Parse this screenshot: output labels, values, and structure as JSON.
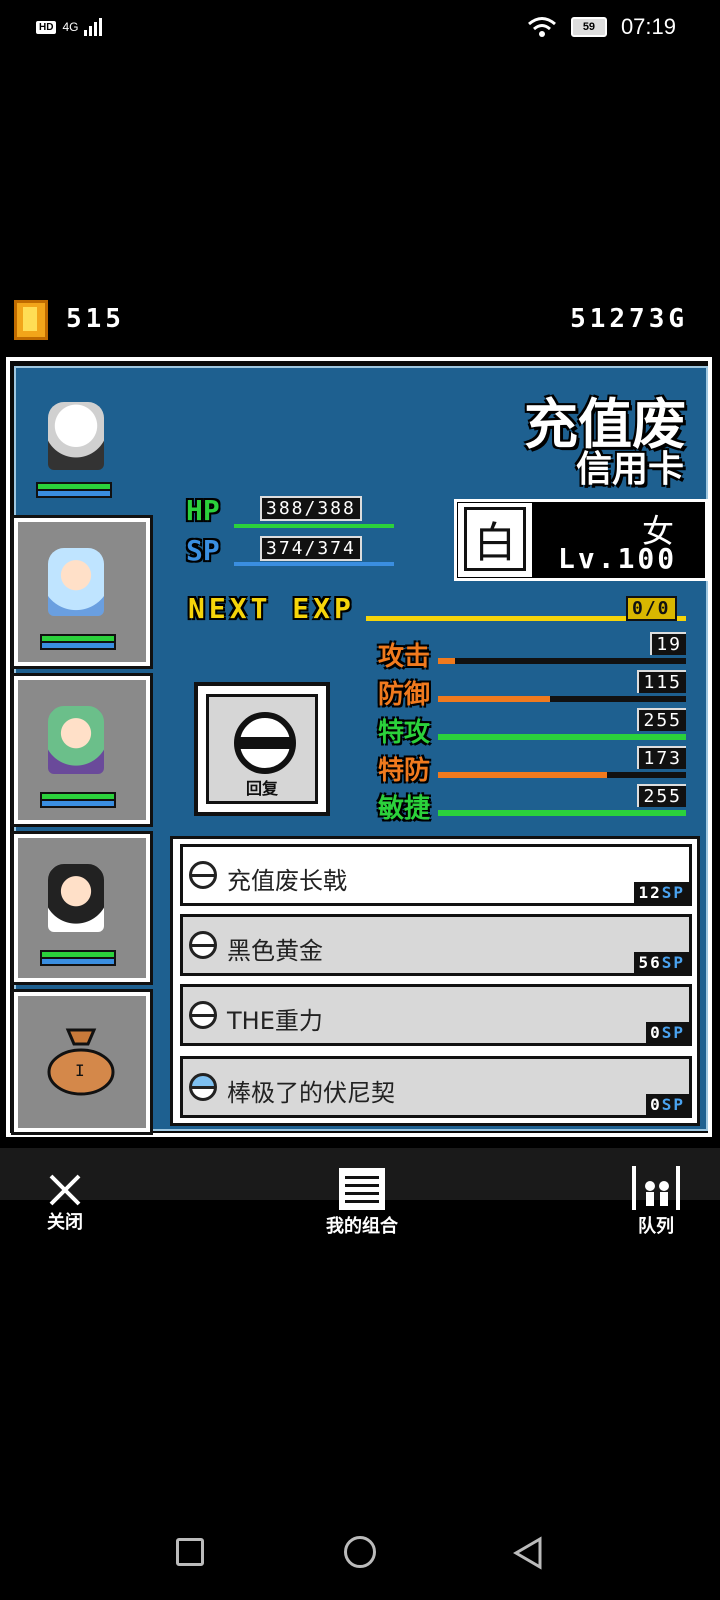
{
  "status_bar": {
    "hd": "HD",
    "network": "4G",
    "battery": "59",
    "time": "07:19"
  },
  "currency": {
    "coins": "515",
    "gold": "51273G"
  },
  "character": {
    "name": "充值废",
    "title": "信用卡",
    "gender": "女",
    "level": "Lv.100",
    "element_char": "白",
    "hp_label": "HP",
    "hp_value": "388/388",
    "sp_label": "SP",
    "sp_value": "374/374",
    "exp_label": "NEXT EXP",
    "exp_value": "0/0"
  },
  "stats": [
    {
      "label": "攻击",
      "value": "19",
      "fraction": 0.07,
      "color": "#f07a1e"
    },
    {
      "label": "防御",
      "value": "115",
      "fraction": 0.45,
      "color": "#f07a1e"
    },
    {
      "label": "特攻",
      "value": "255",
      "fraction": 1.0,
      "color": "#2bd13b"
    },
    {
      "label": "特防",
      "value": "173",
      "fraction": 0.68,
      "color": "#f07a1e"
    },
    {
      "label": "敏捷",
      "value": "255",
      "fraction": 1.0,
      "color": "#2bd13b"
    }
  ],
  "recover_button": {
    "label": "回复"
  },
  "skills": [
    {
      "name": "充值废长戟",
      "cost": "12",
      "unit": "SP"
    },
    {
      "name": "黑色黄金",
      "cost": "56",
      "unit": "SP"
    },
    {
      "name": "THE重力",
      "cost": "0",
      "unit": "SP"
    },
    {
      "name": "棒极了的伏尼契",
      "cost": "0",
      "unit": "SP"
    }
  ],
  "bottom_nav": {
    "close": "关闭",
    "combo": "我的组合",
    "queue": "队列"
  },
  "colors": {
    "panel_bg": "#1e6090",
    "hp_green": "#2bd13b",
    "sp_blue": "#3a8ee0",
    "exp_yellow": "#f5d40a",
    "stat_orange": "#f07a1e"
  }
}
